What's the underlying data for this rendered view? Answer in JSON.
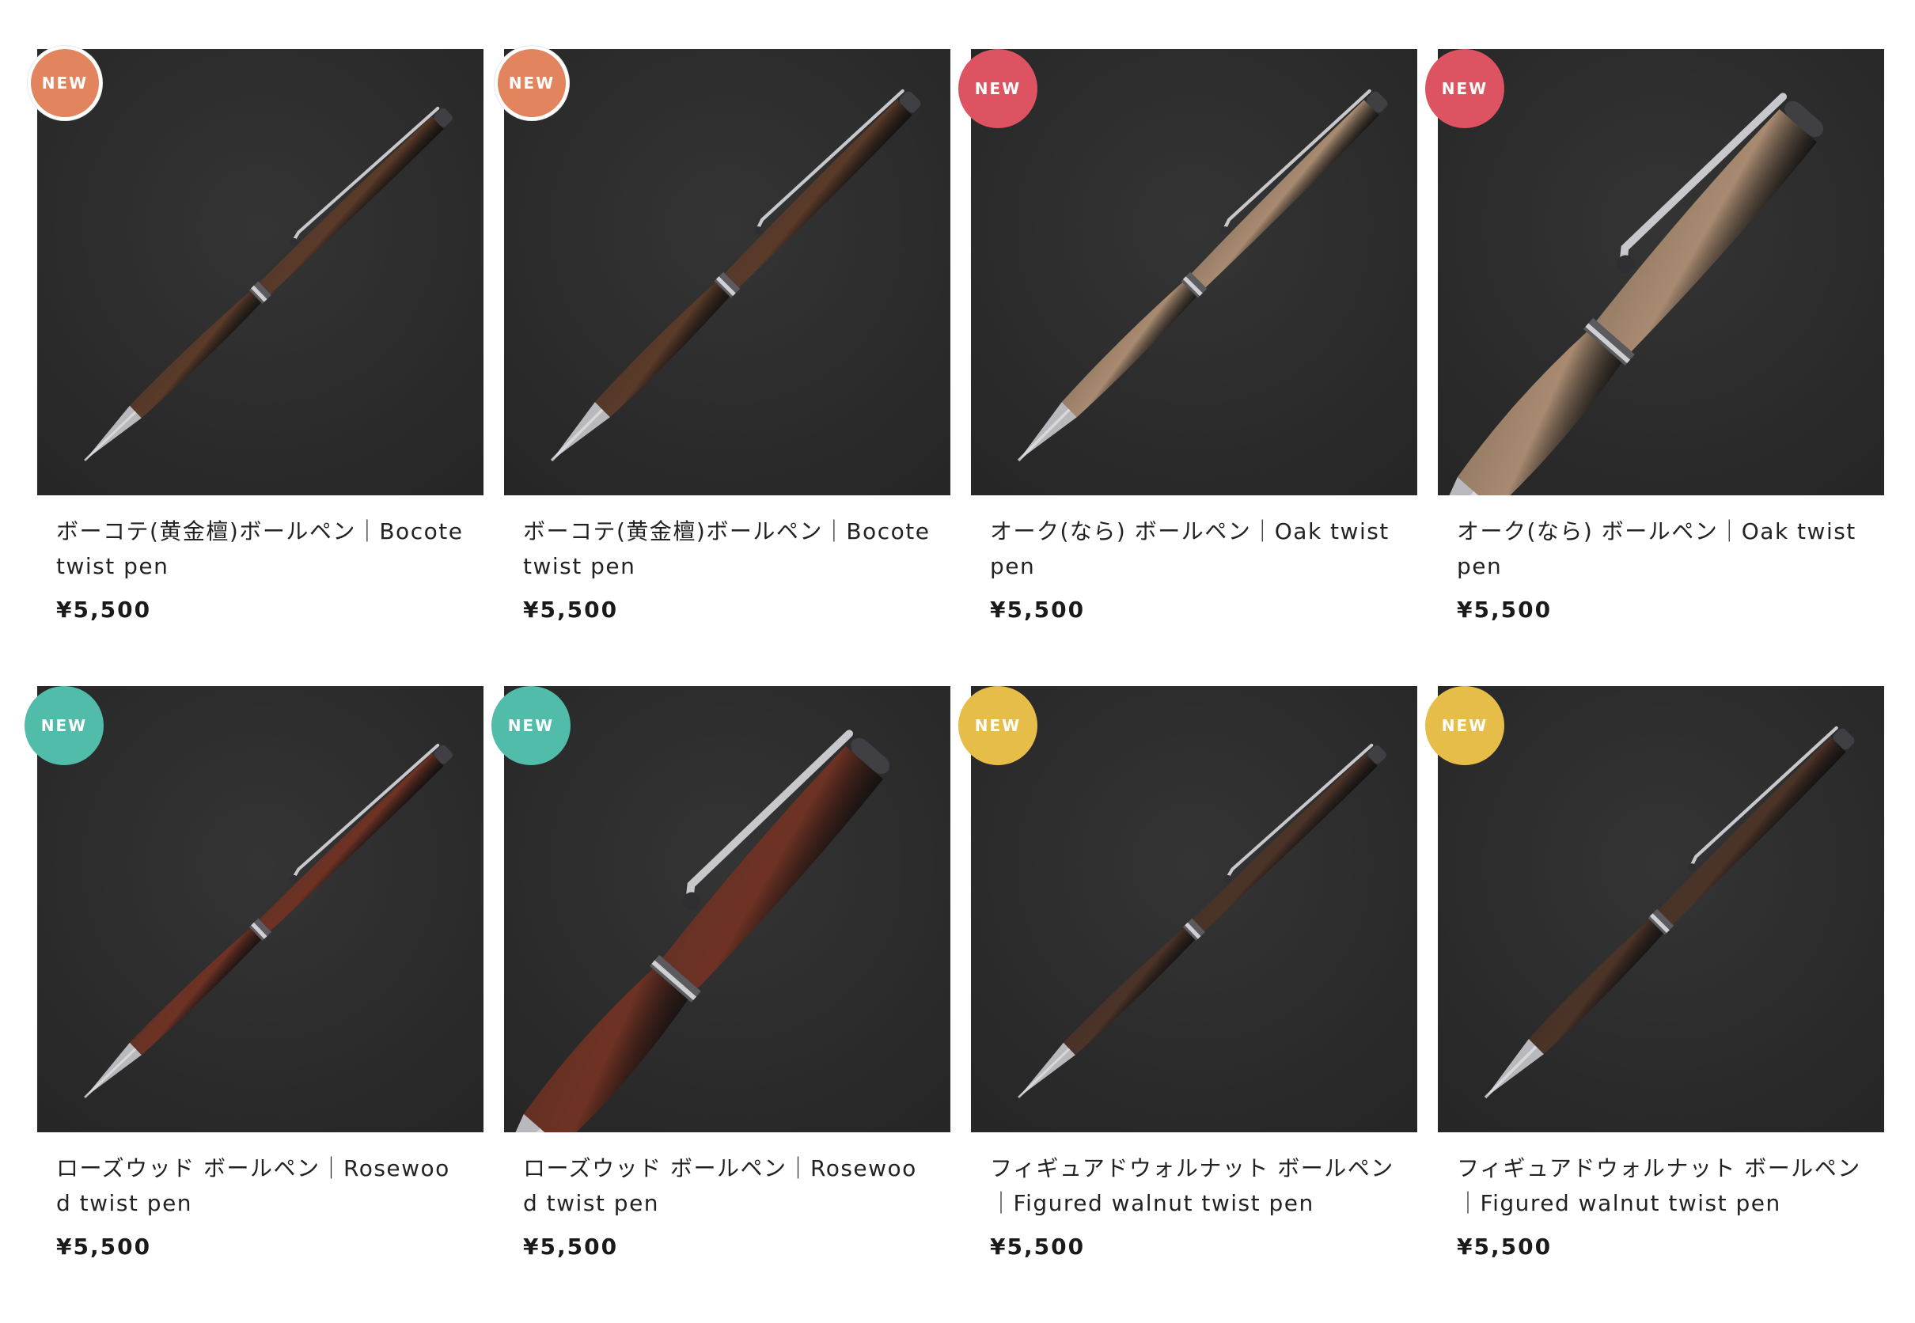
{
  "products": [
    {
      "title": "ボーコテ(黄金檀)ボールペン｜Bocote twist pen",
      "price": "¥5,500",
      "badge": "NEW",
      "badge_color": "#e2855e",
      "badge_style": "outlined",
      "wood": "bocote",
      "view": "full"
    },
    {
      "title": "ボーコテ(黄金檀)ボールペン｜Bocote twist pen",
      "price": "¥5,500",
      "badge": "NEW",
      "badge_color": "#e2855e",
      "badge_style": "outlined",
      "wood": "bocote",
      "view": "side"
    },
    {
      "title": "オーク(なら) ボールペン｜Oak twist pen",
      "price": "¥5,500",
      "badge": "NEW",
      "badge_color": "#dd5361",
      "badge_style": "plain",
      "wood": "oak",
      "view": "side"
    },
    {
      "title": "オーク(なら) ボールペン｜Oak twist pen",
      "price": "¥5,500",
      "badge": "NEW",
      "badge_color": "#dd5361",
      "badge_style": "plain",
      "wood": "oak",
      "view": "close"
    },
    {
      "title": "ローズウッド ボールペン｜Rosewood twist pen",
      "price": "¥5,500",
      "badge": "NEW",
      "badge_color": "#52bcaa",
      "badge_style": "plain",
      "wood": "rosewood",
      "view": "full"
    },
    {
      "title": "ローズウッド ボールペン｜Rosewood twist pen",
      "price": "¥5,500",
      "badge": "NEW",
      "badge_color": "#52bcaa",
      "badge_style": "plain",
      "wood": "rosewood",
      "view": "close"
    },
    {
      "title": "フィギュアドウォルナット ボールペン｜Figured walnut twist pen",
      "price": "¥5,500",
      "badge": "NEW",
      "badge_color": "#e7bd49",
      "badge_style": "plain",
      "wood": "walnut",
      "view": "full"
    },
    {
      "title": "フィギュアドウォルナット ボールペン｜Figured walnut twist pen",
      "price": "¥5,500",
      "badge": "NEW",
      "badge_color": "#e7bd49",
      "badge_style": "plain",
      "wood": "walnut",
      "view": "side"
    }
  ],
  "colors": {
    "bocote": "#5a3a29",
    "oak": "#a88a70",
    "rosewood": "#6e3224",
    "walnut": "#4c3328",
    "background": "#262626"
  }
}
